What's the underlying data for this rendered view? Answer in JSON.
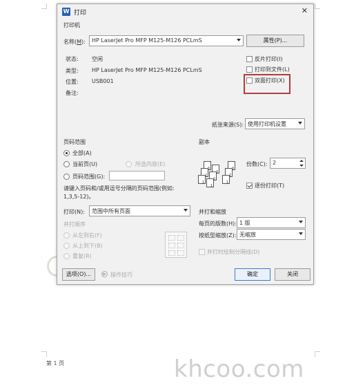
{
  "dialog": {
    "title": "打印",
    "app_icon": "W",
    "close_glyph": "✕",
    "printer_section": "打印机",
    "name_label": "名称(",
    "name_key": "M",
    "name_suffix": "):",
    "printer_name": "HP LaserJet Pro MFP M125-M126 PCLmS",
    "properties_button": "属性(P)...",
    "status_label": "状态:",
    "status_value": "空闲",
    "type_label": "类型:",
    "type_value": "HP LaserJet Pro MFP M125-M126 PCLmS",
    "location_label": "位置:",
    "location_value": "USB001",
    "comment_label": "备注:",
    "reverse_print": "反片打印(I)",
    "print_to_file": "打印到文件(L)",
    "duplex_print": "双面打印(X)",
    "paper_source_label": "纸张来源(S):",
    "paper_source_value": "使用打印机设置",
    "page_range_section": "页码范围",
    "all_option": "全部(A)",
    "current_page_option": "当前页(U)",
    "selection_option": "所选内容(E)",
    "page_range_option": "页码范围(G):",
    "range_hint_line1": "请键入页码和/或用逗号分隔的页码范围(例如:",
    "range_hint_line2": "1,3,5-12)。",
    "copies_section": "副本",
    "copies_label": "份数(C):",
    "copies_value": "2",
    "collate_label": "逐份打印(T)",
    "print_label": "打印(N):",
    "print_value": "范围中所有页面",
    "order_section": "并打顺序",
    "order_left_right": "从左到右(F)",
    "order_top_bottom": "从上到下(B)",
    "order_repeat": "重复(R)",
    "zoom_section": "并打和缩放",
    "pages_per_sheet_label": "每页的版数(H):",
    "pages_per_sheet_value": "1 版",
    "scale_label": "按纸型缩放(Z):",
    "scale_value": "无缩放",
    "draw_lines_label": "并打时绘制分隔线(D)",
    "options_button": "选项(O)...",
    "tips_label": "操作技巧",
    "ok_button": "确定",
    "close_button": "关闭"
  },
  "preview_labels": [
    "1",
    "2",
    "3"
  ],
  "background": {
    "footer_text": "第 1 页",
    "watermark": "khcoo.com"
  },
  "colors": {
    "highlight_box": "#b53a3a",
    "app_icon_bg": "#2b5fb4"
  }
}
